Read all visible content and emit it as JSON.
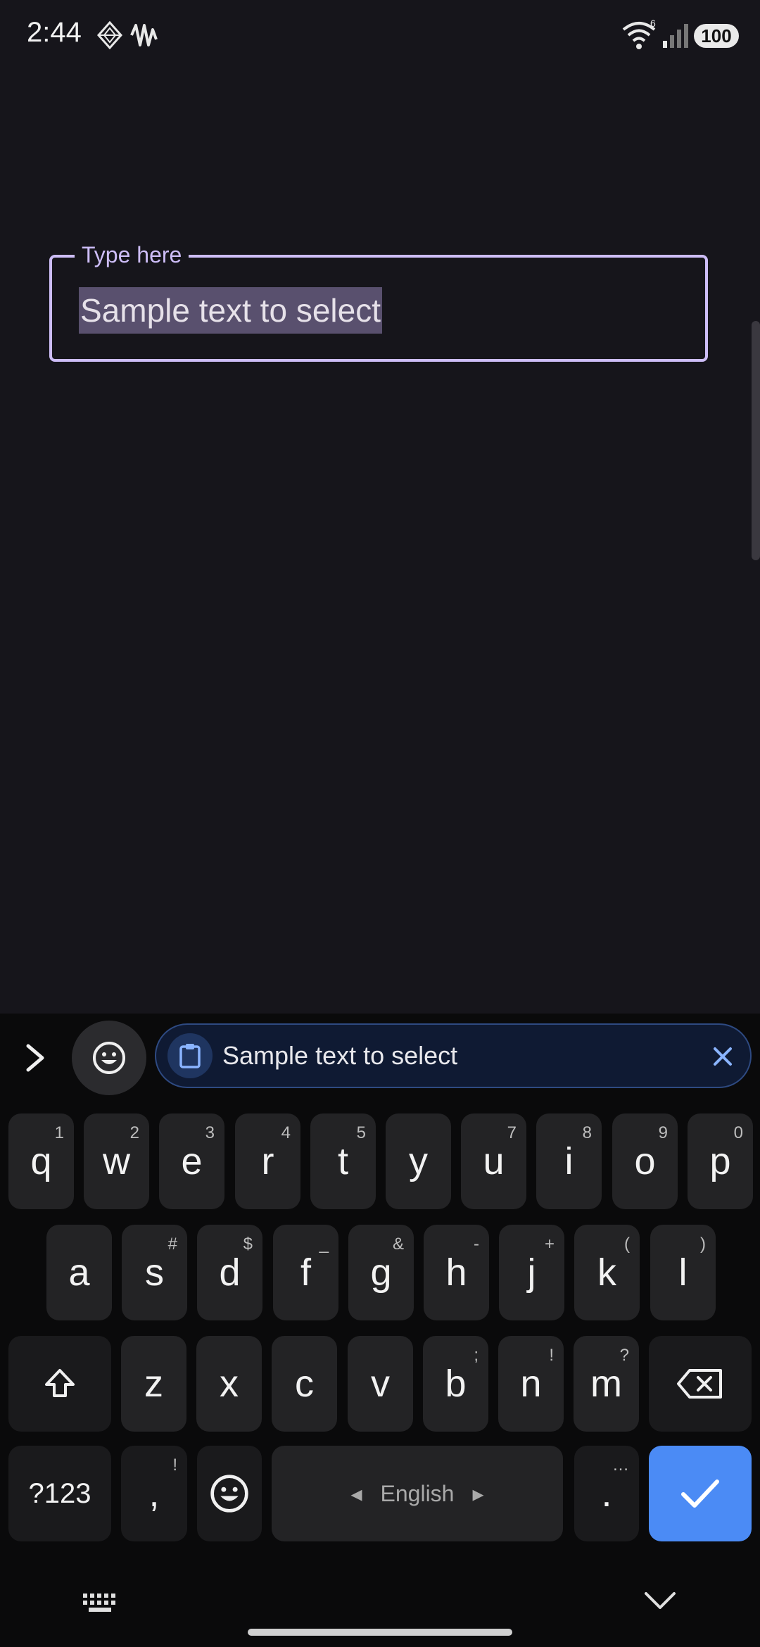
{
  "status_bar": {
    "time": "2:44",
    "battery": "100",
    "icons": [
      "diamond-app-icon",
      "waveform-icon",
      "wifi-icon",
      "signal-icon",
      "battery-icon"
    ],
    "wifi_badge": "6"
  },
  "text_field": {
    "label": "Type here",
    "value": "Sample text to select",
    "selected": true,
    "border_color": "#cdbdf7",
    "selection_color": "#59506e"
  },
  "keyboard": {
    "clipboard_suggestion": "Sample text to select",
    "rows": [
      [
        {
          "label": "q",
          "hint": "1"
        },
        {
          "label": "w",
          "hint": "2"
        },
        {
          "label": "e",
          "hint": "3"
        },
        {
          "label": "r",
          "hint": "4"
        },
        {
          "label": "t",
          "hint": "5"
        },
        {
          "label": "y",
          "hint": ""
        },
        {
          "label": "u",
          "hint": "7"
        },
        {
          "label": "i",
          "hint": "8"
        },
        {
          "label": "o",
          "hint": "9"
        },
        {
          "label": "p",
          "hint": "0"
        }
      ],
      [
        {
          "label": "a",
          "hint": ""
        },
        {
          "label": "s",
          "hint": "#"
        },
        {
          "label": "d",
          "hint": "$"
        },
        {
          "label": "f",
          "hint": "_"
        },
        {
          "label": "g",
          "hint": "&"
        },
        {
          "label": "h",
          "hint": "-"
        },
        {
          "label": "j",
          "hint": "+"
        },
        {
          "label": "k",
          "hint": "("
        },
        {
          "label": "l",
          "hint": ")"
        }
      ],
      [
        {
          "label": "z",
          "hint": ""
        },
        {
          "label": "x",
          "hint": ""
        },
        {
          "label": "c",
          "hint": ""
        },
        {
          "label": "v",
          "hint": ""
        },
        {
          "label": "b",
          "hint": ";"
        },
        {
          "label": "n",
          "hint": "!"
        },
        {
          "label": "m",
          "hint": "?"
        }
      ]
    ],
    "symbols_key": "?123",
    "comma_key": ",",
    "comma_hint": "!",
    "space_label": "English",
    "space_left_arrow": "◂",
    "space_right_arrow": "▸",
    "period_key": ".",
    "period_hint": "…",
    "accent_color": "#4b8bf5"
  }
}
